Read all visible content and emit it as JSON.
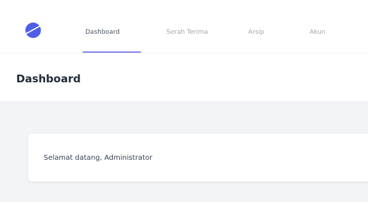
{
  "nav": {
    "logo_icon": "planet-logo-icon",
    "items": [
      {
        "label": "Dashboard",
        "active": true
      },
      {
        "label": "Serah Terima",
        "active": false
      },
      {
        "label": "Arsip",
        "active": false
      },
      {
        "label": "Akun",
        "active": false
      }
    ]
  },
  "header": {
    "title": "Dashboard"
  },
  "main": {
    "welcome_text": "Selamat datang, Administrator"
  },
  "colors": {
    "brand_blue": "#4f5ee6",
    "accent_underline": "#8b83ec",
    "page_background": "#f3f4f6"
  }
}
